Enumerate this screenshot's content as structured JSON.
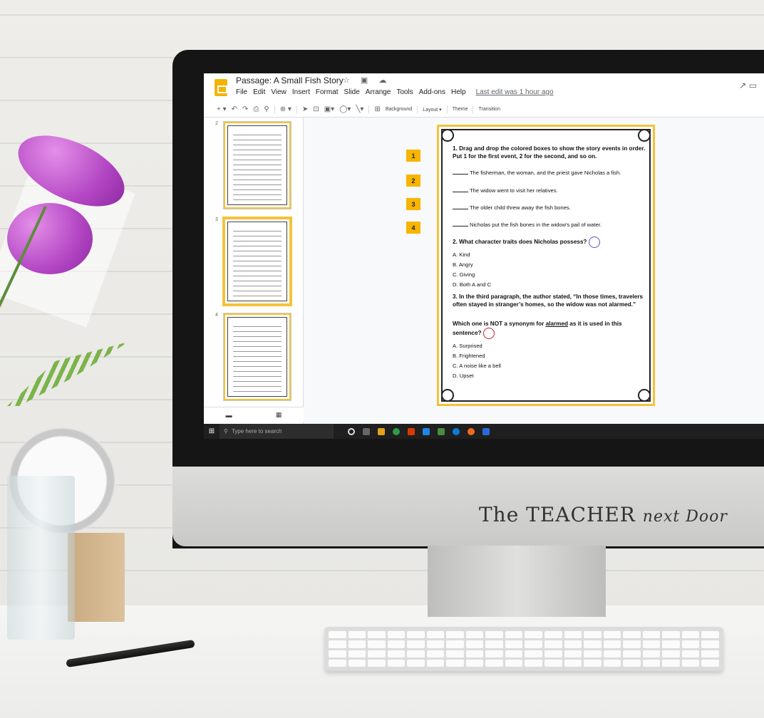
{
  "app": {
    "doc_title": "Passage: A Small Fish Story",
    "last_edit": "Last edit was 1 hour ago",
    "menu": [
      "File",
      "Edit",
      "View",
      "Insert",
      "Format",
      "Slide",
      "Arrange",
      "Tools",
      "Add-ons",
      "Help"
    ]
  },
  "toolbar": {
    "background_label": "Background",
    "layout_label": "Layout ▾",
    "theme_label": "Theme",
    "transition_label": "Transition"
  },
  "filmstrip": {
    "slides": [
      {
        "number": "2"
      },
      {
        "number": "3"
      },
      {
        "number": "4"
      }
    ]
  },
  "slide": {
    "number_boxes": [
      "1",
      "2",
      "3",
      "4"
    ],
    "q1": {
      "prompt": "1. Drag and drop the colored boxes to show the story events in order. Put 1 for the first event, 2 for the second, and so on.",
      "events": [
        "The fisherman, the woman, and the priest gave Nicholas a fish.",
        "The widow went to visit her relatives.",
        "The older child threw away the fish bones.",
        "Nicholas put the fish bones in the widow's pail of water."
      ]
    },
    "q2": {
      "prompt": "2. What character traits does Nicholas possess?",
      "options": [
        "A. Kind",
        "B. Angry",
        "C. Giving",
        "D. Both A and C"
      ]
    },
    "q3": {
      "prompt": "3. In the third paragraph, the author stated, “In those times, travelers often stayed in stranger’s homes, so the widow was not alarmed.”",
      "prompt2_pre": "Which one is ",
      "prompt2_not": "NOT",
      "prompt2_mid": " a synonym for ",
      "prompt2_word": "alarmed",
      "prompt2_post": " as it is used in this sentence?",
      "options": [
        "A. Surprised",
        "B. Frightened",
        "C. A noise like a bell",
        "D. Upset"
      ]
    }
  },
  "taskbar": {
    "search_placeholder": "Type here to search"
  },
  "branding": {
    "text": "The TEACHER next Door"
  },
  "colors": {
    "accent_yellow": "#f4c23a",
    "number_box": "#f7b500",
    "circle_purple": "#6a4fbf",
    "circle_red": "#c3272b"
  }
}
